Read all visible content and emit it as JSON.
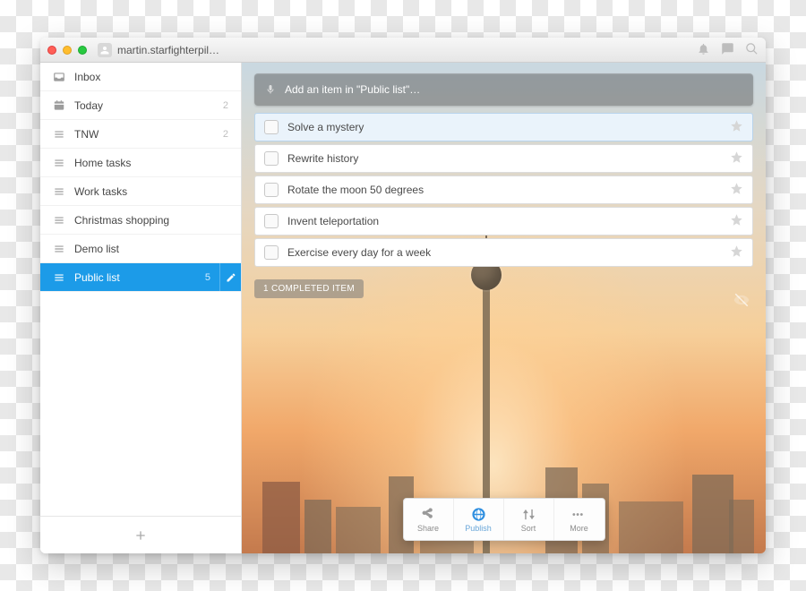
{
  "header": {
    "username": "martin.starfighterpil…"
  },
  "sidebar": {
    "items": [
      {
        "label": "Inbox",
        "icon": "inbox",
        "count": ""
      },
      {
        "label": "Today",
        "icon": "calendar",
        "count": "2"
      },
      {
        "label": "TNW",
        "icon": "list",
        "count": "2"
      },
      {
        "label": "Home tasks",
        "icon": "list",
        "count": ""
      },
      {
        "label": "Work tasks",
        "icon": "list",
        "count": ""
      },
      {
        "label": "Christmas shopping",
        "icon": "list",
        "count": ""
      },
      {
        "label": "Demo list",
        "icon": "list",
        "count": ""
      },
      {
        "label": "Public list",
        "icon": "list",
        "count": "5",
        "active": true
      }
    ]
  },
  "main": {
    "add_placeholder": "Add an item in \"Public list\"…",
    "tasks": [
      {
        "label": "Solve a mystery",
        "selected": true
      },
      {
        "label": "Rewrite history"
      },
      {
        "label": "Rotate the moon 50 degrees"
      },
      {
        "label": "Invent teleportation"
      },
      {
        "label": "Exercise every day for a week"
      }
    ],
    "completed_label": "1 COMPLETED ITEM",
    "toolbar": [
      {
        "label": "Share",
        "icon": "share"
      },
      {
        "label": "Publish",
        "icon": "globe",
        "highlight": true
      },
      {
        "label": "Sort",
        "icon": "sort"
      },
      {
        "label": "More",
        "icon": "more"
      }
    ]
  }
}
